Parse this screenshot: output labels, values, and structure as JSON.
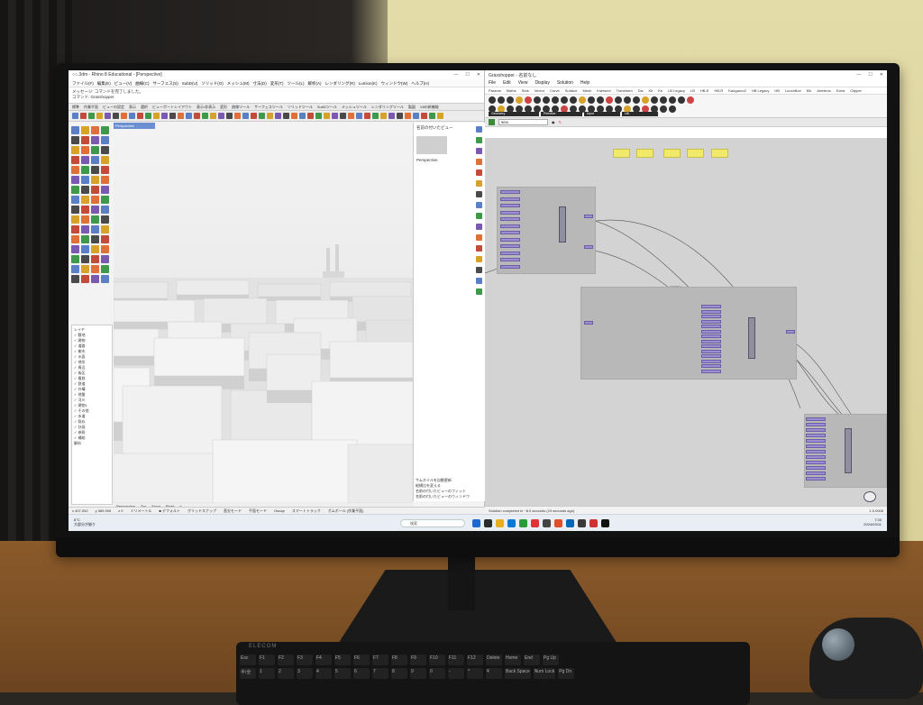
{
  "rhino": {
    "title": "○○.3dm - Rhino 8 Educational - [Perspective]",
    "menu": [
      "ファイル(F)",
      "編集(E)",
      "ビュー(V)",
      "曲線(C)",
      "サーフェス(S)",
      "SubD(U)",
      "ソリッド(O)",
      "メッシュ(M)",
      "寸法(D)",
      "変形(T)",
      "ツール(L)",
      "解析(A)",
      "レンダリング(R)",
      "Lumion(K)",
      "ウィンドウ(W)",
      "ヘルプ(H)"
    ],
    "command_lines": [
      "メッセージ: コマンドを完了しました。",
      "コマンド: Grasshopper"
    ],
    "toolbar_tabs": [
      "標準",
      "作業平面",
      "ビューの設定",
      "表示",
      "選択",
      "ビューポートレイアウト",
      "表示/非表示",
      "変形",
      "曲線ツール",
      "サーフェスツール",
      "ソリッドツール",
      "SubDツール",
      "メッシュツール",
      "レンダリングツール",
      "製図",
      "V8の新機能"
    ],
    "viewport_label": "Perspective",
    "view_tabs": [
      "Perspective",
      "Top",
      "Front",
      "Right",
      "+"
    ],
    "layers_title": "レイヤ",
    "layers": [
      "✓ 敷地",
      "✓ 建物",
      "✓ 道路",
      "✓ 樹木",
      "✓ 水面",
      "✓ 地形",
      "✓ 周辺",
      "✓ 街区",
      "✓ 植栽",
      "✓ 鉄道",
      "✓ 外構",
      "✓ 地盤",
      "✓ 河川",
      "✓ 建物1",
      "✓ その他",
      "✓ 歩道",
      "✓ 既存",
      "✓ 計画",
      "✓ 参照",
      "✓ 補助",
      "  解析"
    ],
    "named_views_title": "名前の付いたビュー",
    "named_view_item": "Perspective",
    "checks": [
      "サムネイルを自動更新",
      "縦横比を変える",
      "名前の付いたビューのフィット",
      "名前の付いたビューのウィンドウ"
    ],
    "status_items": [
      "x 407.052",
      "y 589.905",
      "z 0",
      "ミリメートル",
      "■ デフォルト",
      "グリッドスナップ",
      "直交モード",
      "平面モード",
      "Osnap",
      "スマートトラック",
      "ガムボール (作業平面)"
    ]
  },
  "grasshopper": {
    "title": "Grasshopper - 名前なし",
    "menu": [
      "File",
      "Edit",
      "View",
      "Display",
      "Solution",
      "Help"
    ],
    "tabs": [
      "Params",
      "Maths",
      "Sets",
      "Vector",
      "Curve",
      "Surface",
      "Mesh",
      "Intersect",
      "Transform",
      "Dis",
      "Kk",
      "Ke",
      "LB Legacy",
      "LB",
      "HB-E",
      "HB-R",
      "Kangaroo2",
      "HB Legacy",
      "HB",
      "LunchBox",
      "Elk",
      "Ambiens",
      "Extra",
      "Clipper"
    ],
    "groups": [
      "Geometry",
      "Primitive",
      "Input",
      "Util"
    ],
    "zoom": "90%",
    "status": "Solution completed in ~8.0 seconds (19 seconds ago)",
    "version": "1.0.0008"
  },
  "taskbar": {
    "weather_temp": "6°C",
    "weather_desc": "大部分が曇り",
    "search_placeholder": "検索",
    "time": "7:33",
    "date": "2024/03/11"
  },
  "keyboard": {
    "brand": "ELECOM",
    "row1": [
      "Esc",
      "F1",
      "F2",
      "F3",
      "F4",
      "F5",
      "F6",
      "F7",
      "F8",
      "F9",
      "F10",
      "F11",
      "F12",
      "Delete",
      "Home",
      "End",
      "Pg Up"
    ],
    "row2": [
      "半/全",
      "1",
      "2",
      "3",
      "4",
      "5",
      "6",
      "7",
      "8",
      "9",
      "0",
      "-",
      "^",
      "¥",
      "Back Space",
      "Num Lock",
      "Pg Dn"
    ]
  },
  "colors": {
    "viewport_selected": "#6b8fd0",
    "gh_param": "#9d8ed0",
    "gh_note": "#f0e96a"
  }
}
